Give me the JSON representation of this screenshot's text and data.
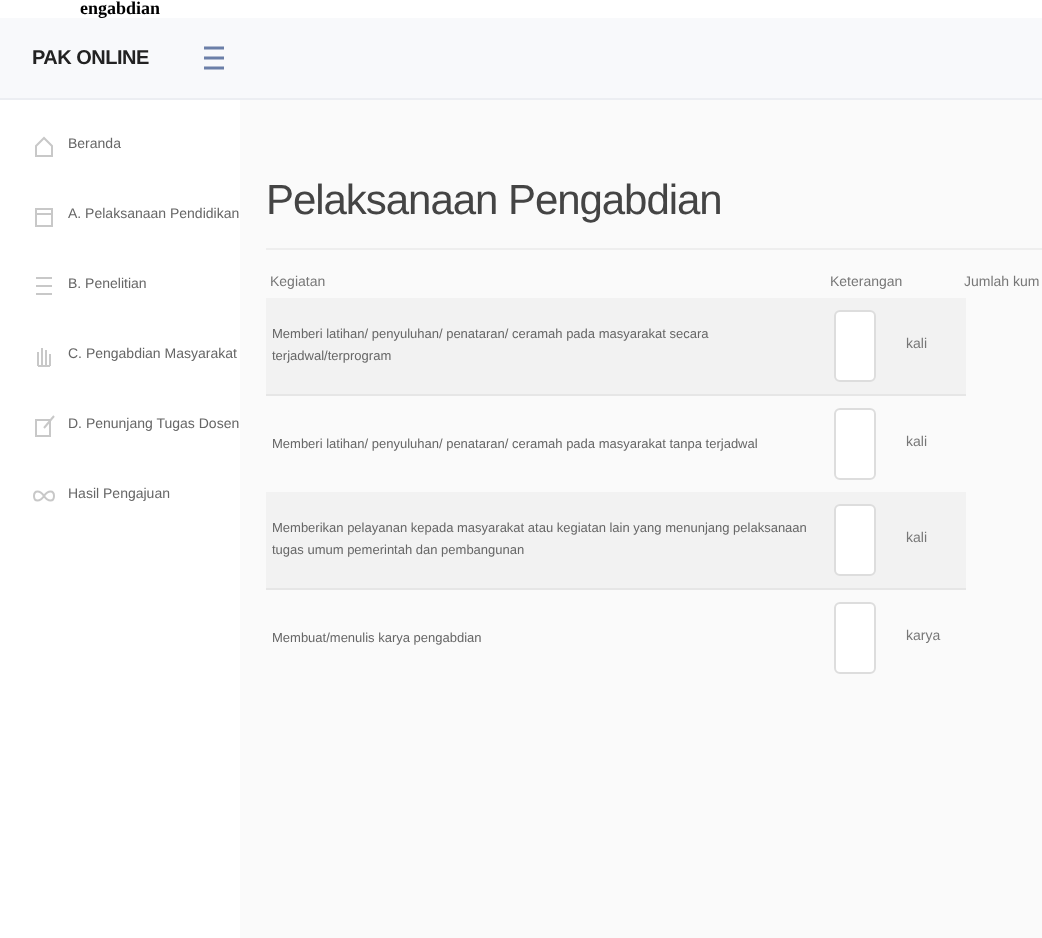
{
  "top_strip": {
    "text": "engabdian"
  },
  "header": {
    "logo": "PAK ONLINE"
  },
  "sidebar": {
    "items": [
      {
        "label": "Beranda"
      },
      {
        "label": "A. Pelaksanaan Pendidikan"
      },
      {
        "label": "B. Penelitian"
      },
      {
        "label": "C. Pengabdian Masyarakat"
      },
      {
        "label": "D. Penunjang Tugas Dosen"
      },
      {
        "label": "Hasil Pengajuan"
      }
    ]
  },
  "page": {
    "title": "Pelaksanaan Pengabdian",
    "table": {
      "columns": [
        "Kegiatan",
        "Keterangan",
        "Jumlah kum"
      ],
      "rows": [
        {
          "activity": "Memberi latihan/ penyuluhan/ penataran/ ceramah pada masyarakat secara terjadwal/terprogram",
          "unit": "kali"
        },
        {
          "activity": "Memberi latihan/ penyuluhan/ penataran/ ceramah pada masyarakat tanpa terjadwal",
          "unit": "kali"
        },
        {
          "activity": "Memberikan pelayanan kepada masyarakat atau kegiatan lain yang menunjang pelaksanaan tugas umum pemerintah dan pembangunan",
          "unit": "kali"
        },
        {
          "activity": "Membuat/menulis karya pengabdian",
          "unit": "karya"
        }
      ]
    }
  }
}
